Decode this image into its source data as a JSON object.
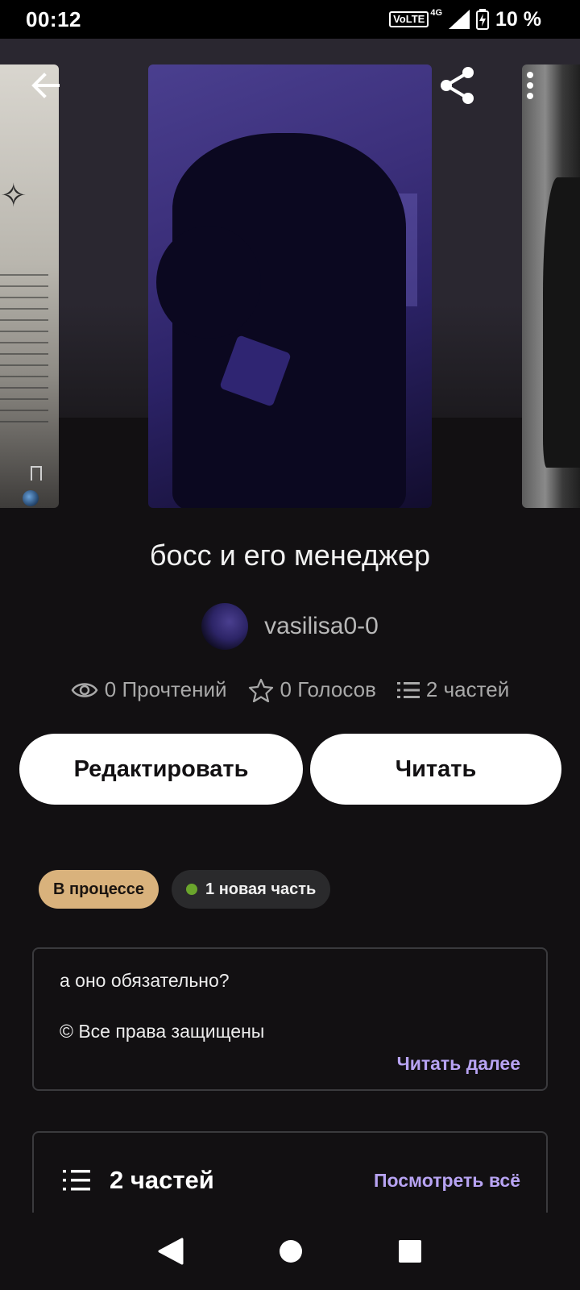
{
  "status_bar": {
    "time": "00:12",
    "volte": "VoLTE",
    "network": "4G",
    "battery": "10 %"
  },
  "story": {
    "title": "босс и его менеджер",
    "author": "vasilisa0-0"
  },
  "stats": {
    "reads": "0 Прочтений",
    "votes": "0 Голосов",
    "parts": "2 частей"
  },
  "actions": {
    "edit_label": "Редактировать",
    "read_label": "Читать"
  },
  "badges": {
    "status": "В процессе",
    "new_parts": "1 новая часть"
  },
  "description": {
    "line1": "а оно обязательно?",
    "line2": "© Все права защищены",
    "read_more": "Читать далее"
  },
  "parts_section": {
    "title": "2 частей",
    "view_all": "Посмотреть всё"
  },
  "colors": {
    "background": "#121012",
    "accent": "#b7a3f2",
    "status_badge": "#d9b27c",
    "new_dot": "#6aa52c"
  },
  "icons": [
    "back-arrow-icon",
    "share-icon",
    "more-vertical-icon",
    "eye-icon",
    "star-icon",
    "list-icon",
    "nav-back-icon",
    "nav-home-icon",
    "nav-recents-icon"
  ]
}
